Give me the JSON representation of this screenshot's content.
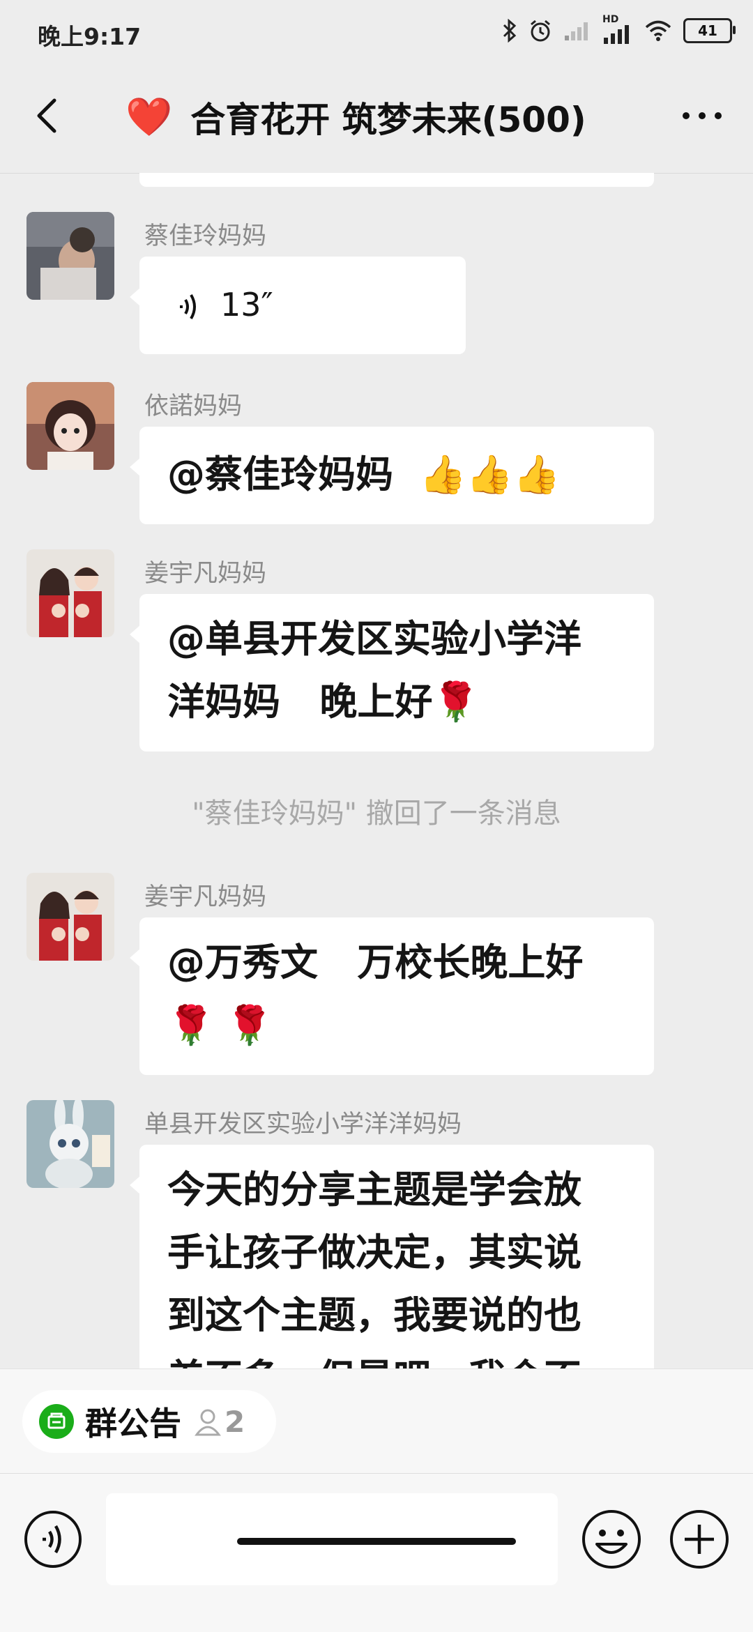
{
  "status_bar": {
    "time": "晚上9:17",
    "battery": "41",
    "network_label": "HD",
    "icons": [
      "bluetooth-icon",
      "alarm-icon",
      "signal-weak-icon",
      "signal-icon",
      "wifi-icon",
      "battery-icon"
    ]
  },
  "header": {
    "title": "合育花开 筑梦未来(500)",
    "heart_emoji": "❤️",
    "icons": [
      "back-icon",
      "more-icon"
    ]
  },
  "messages": [
    {
      "sender": "蔡佳玲妈妈",
      "type": "voice",
      "duration": "13″"
    },
    {
      "sender": "依諾妈妈",
      "type": "text",
      "text": "@蔡佳玲妈妈  ",
      "emoji": "👍👍👍"
    },
    {
      "sender": "姜宇凡妈妈",
      "type": "text",
      "line1": "@单县开发区实验小学洋",
      "line2": "洋妈妈   晚上好",
      "emoji": "🌹"
    },
    {
      "type": "system",
      "text": "\"蔡佳玲妈妈\" 撤回了一条消息"
    },
    {
      "sender": "姜宇凡妈妈",
      "type": "text",
      "line1": "@万秀文   万校长晚上好",
      "emoji": "🌹 🌹"
    },
    {
      "sender": "单县开发区实验小学洋洋妈妈",
      "type": "text",
      "line1": "今天的分享主题是学会放",
      "line2": "手让孩子做决定，其实说",
      "line3": "到这个主题，我要说的也",
      "line4": "差不多，但是吧，我会不"
    }
  ],
  "notice": {
    "label": "群公告",
    "count": "2"
  },
  "input_bar": {
    "icons": [
      "voice-input-icon",
      "emoji-icon",
      "plus-icon"
    ]
  }
}
